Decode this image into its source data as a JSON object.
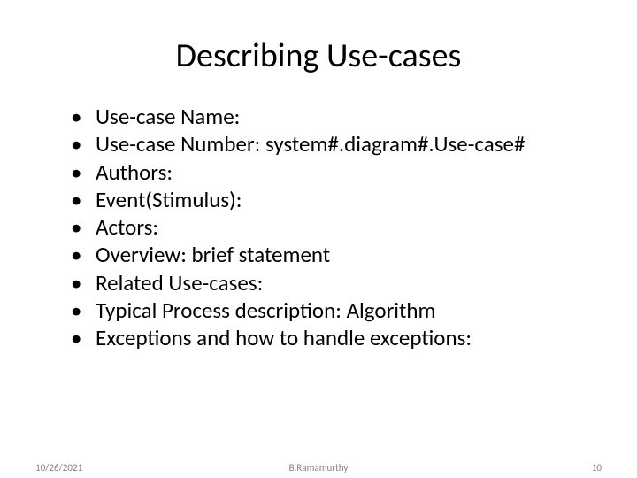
{
  "title": "Describing Use-cases",
  "bullets": [
    "Use-case Name:",
    "Use-case Number: system#.diagram#.Use-case#",
    "Authors:",
    "Event(Stimulus):",
    "Actors:",
    "Overview: brief statement",
    "Related Use-cases:",
    "Typical Process description: Algorithm",
    "Exceptions and how to handle exceptions:"
  ],
  "footer": {
    "date": "10/26/2021",
    "author": "B.Ramamurthy",
    "page": "10"
  }
}
